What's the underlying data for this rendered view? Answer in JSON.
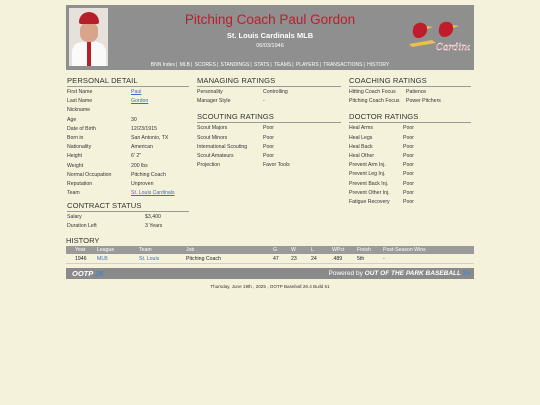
{
  "header": {
    "name": "Pitching Coach Paul Gordon",
    "team": "St. Louis Cardinals MLB",
    "date": "06/03/1946",
    "logo_text": "Cardinals",
    "nav": [
      "BNN Index",
      "MLB",
      "SCORES",
      "STANDINGS",
      "STATS",
      "TEAMS",
      "PLAYERS",
      "TRANSACTIONS",
      "HISTORY"
    ]
  },
  "personal": {
    "title": "PERSONAL DETAIL",
    "rows": [
      {
        "k": "First Name",
        "v": "Paul"
      },
      {
        "k": "Last Name",
        "v": "Gordon"
      },
      {
        "k": "Nickname",
        "v": ""
      },
      {
        "k": "Age",
        "v": "30"
      },
      {
        "k": "Date of Birth",
        "v": "12/23/1915"
      },
      {
        "k": "Born in",
        "v": "San Antonio, TX"
      },
      {
        "k": "Nationality",
        "v": "American"
      },
      {
        "k": "Height",
        "v": "6' 2\""
      },
      {
        "k": "Weight",
        "v": "200 lbs"
      },
      {
        "k": "Normal Occupation",
        "v": "Pitching Coach"
      },
      {
        "k": "Reputation",
        "v": "Unproven"
      },
      {
        "k": "Team",
        "v": "St. Louis Cardinals"
      }
    ]
  },
  "contract": {
    "title": "CONTRACT STATUS",
    "rows": [
      {
        "k": "Salary",
        "v": "$3,400"
      },
      {
        "k": "Duration Left",
        "v": "3 Years"
      }
    ]
  },
  "managing": {
    "title": "MANAGING RATINGS",
    "rows": [
      {
        "k": "Personality",
        "v": "Controlling"
      },
      {
        "k": "Manager Style",
        "v": "-"
      }
    ]
  },
  "scouting": {
    "title": "SCOUTING RATINGS",
    "rows": [
      {
        "k": "Scout Majors",
        "v": "Poor"
      },
      {
        "k": "Scout Minors",
        "v": "Poor"
      },
      {
        "k": "International Scouting",
        "v": "Poor"
      },
      {
        "k": "Scout Amateurs",
        "v": "Poor"
      },
      {
        "k": "Projection",
        "v": "Favor Tools"
      }
    ]
  },
  "coaching": {
    "title": "COACHING RATINGS",
    "rows": [
      {
        "k": "Hitting Coach Focus",
        "v": "Patience"
      },
      {
        "k": "Pitching Coach Focus",
        "v": "Power Pitchers"
      }
    ]
  },
  "doctor": {
    "title": "DOCTOR RATINGS",
    "rows": [
      {
        "k": "Heal Arms",
        "v": "Poor"
      },
      {
        "k": "Heal Legs",
        "v": "Poor"
      },
      {
        "k": "Heal Back",
        "v": "Poor"
      },
      {
        "k": "Heal Other",
        "v": "Poor"
      },
      {
        "k": "Prevent Arm Inj.",
        "v": "Poor"
      },
      {
        "k": "Prevent Leg Inj.",
        "v": "Poor"
      },
      {
        "k": "Prevent Back Inj.",
        "v": "Poor"
      },
      {
        "k": "Prevent Other Inj.",
        "v": "Poor"
      },
      {
        "k": "Fatigue Recovery",
        "v": "Poor"
      }
    ]
  },
  "history": {
    "title": "HISTORY",
    "headers": {
      "year": "Year",
      "league": "League",
      "team": "Team",
      "job": "Job",
      "g": "G",
      "w": "W",
      "l": "L",
      "wpct": "WPct",
      "finish": "Finish",
      "postseason": "Post-Season Wins"
    },
    "row": {
      "year": "1946",
      "league": "MLB",
      "team": "St. Louis",
      "job": "Pitching Coach",
      "g": "47",
      "w": "23",
      "l": "24",
      "wpct": ".489",
      "finish": "5th",
      "postseason": "-"
    }
  },
  "footer": {
    "ootp_left": "OOTP",
    "ootp_right": "26",
    "powered_prefix": "Powered by",
    "powered_brand": "OUT OF THE PARK BASEBALL",
    "powered_num": "26",
    "generated": "Thursday, June 19th , 2025 , OOTP Baseball 26.4 Build 61"
  }
}
